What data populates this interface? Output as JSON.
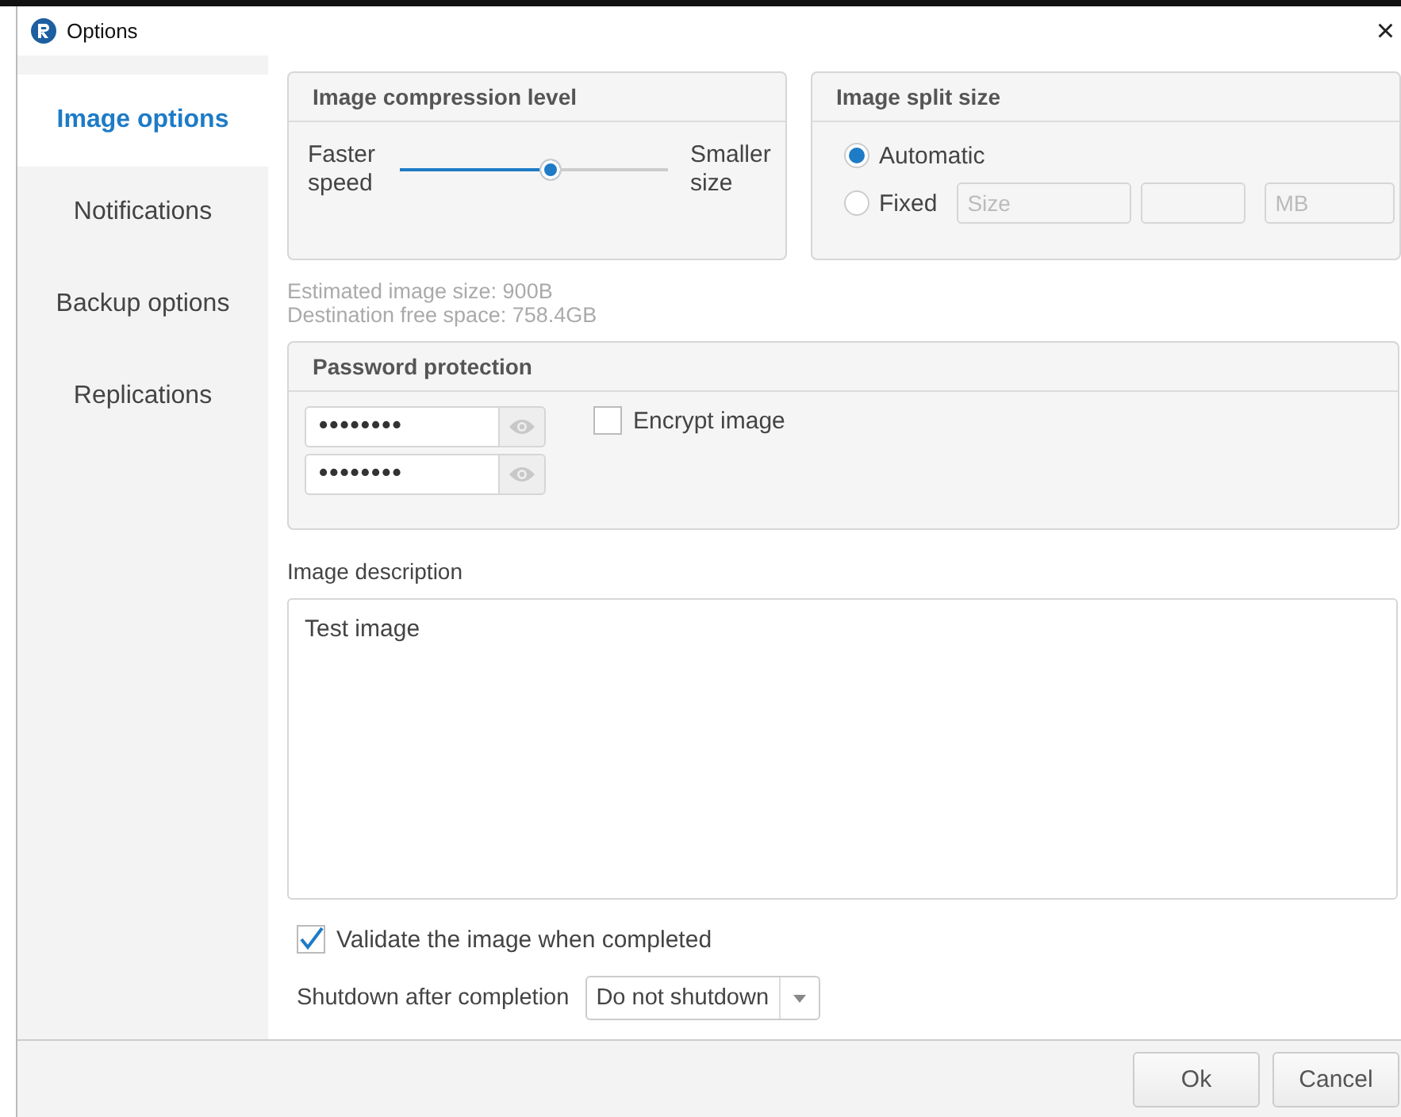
{
  "window": {
    "title": "Options",
    "close": "×"
  },
  "sidebar": {
    "items": [
      {
        "label": "Image options",
        "selected": true
      },
      {
        "label": "Notifications",
        "selected": false
      },
      {
        "label": "Backup options",
        "selected": false
      },
      {
        "label": "Replications",
        "selected": false
      }
    ]
  },
  "compression": {
    "title": "Image compression level",
    "left_label": "Faster speed",
    "right_label": "Smaller size",
    "level": 0.56
  },
  "split": {
    "title": "Image split size",
    "options": [
      {
        "label": "Automatic",
        "selected": true
      },
      {
        "label": "Fixed",
        "selected": false
      }
    ],
    "size_placeholder": "Size",
    "unit_placeholder": "MB"
  },
  "info": [
    "Estimated image size: 900B",
    "Destination free space: 758.4GB"
  ],
  "password": {
    "title": "Password protection",
    "fields": [
      "••••••••",
      "••••••••"
    ],
    "encrypt": {
      "label": "Encrypt image",
      "checked": false
    }
  },
  "description": {
    "label": "Image description",
    "value": "Test image"
  },
  "validate": {
    "label": "Validate the image when completed",
    "checked": true
  },
  "shutdown": {
    "label": "Shutdown after completion",
    "value": "Do not shutdown"
  },
  "buttons": [
    "Ok",
    "Cancel"
  ]
}
